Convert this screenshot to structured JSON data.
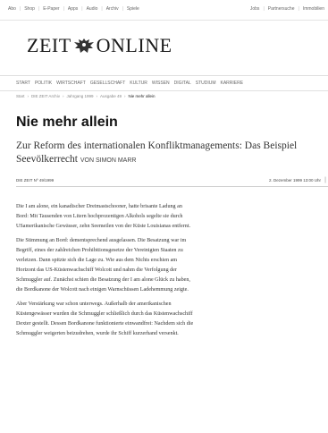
{
  "topnav": {
    "left": [
      "Abo",
      "Shop",
      "E-Paper",
      "Apps",
      "Audio",
      "Archiv",
      "Spiele"
    ],
    "right": [
      "Jobs",
      "Partnersuche",
      "Immobilien"
    ]
  },
  "logo": {
    "part1": "ZEIT",
    "part2": "ONLINE"
  },
  "mainnav": [
    "START",
    "POLITIK",
    "WIRTSCHAFT",
    "GESELLSCHAFT",
    "KULTUR",
    "WISSEN",
    "DIGITAL",
    "STUDIUM",
    "KARRIERE"
  ],
  "breadcrumb": [
    "Start",
    "DIE ZEIT Archiv",
    "Jahrgang 1999",
    "Ausgabe 49",
    "Nie mehr allein"
  ],
  "article": {
    "title": "Nie mehr allein",
    "subtitle": "Zur Reform des internationalen Konfliktmanagements: Das Beispiel Seevölkerrecht",
    "byline": "VON SIMON MARR",
    "issue": "DIE ZEIT Nº 49/1999",
    "date": "2. Dezember 1999  13:00 Uhr",
    "paragraphs": [
      [
        "Die I am alone, ein kanadischer Dreimastschooner, hatte brisante Ladung an",
        "Bord: Mit Tausenden von Litern hochprozentigen Alkohols segelte sie durch",
        "USamerikanische Gewässer, zehn Seemeilen von der Küste Louisianas entfernt."
      ],
      [
        "Die Stimmung an Bord: dementsprechend ausgelassen. Die Besatzung war im",
        "Begriff, eines der zahlreichen Prohibitionsgesetze der Vereinigten Staaten zu",
        "verletzen. Dann spitzte sich die Lage zu. Wie aus dem Nichts erschien am",
        "Horizont das US-Küstenwachschiff Wolcott und nahm die Verfolgung der",
        "Schmuggler auf. Zunächst schien die Besatzung der I am alone Glück zu haben,",
        "die Bordkanone der Wolcott nach einigen Warnschüssen Ladehemmung zeigte."
      ],
      [
        "Aber Verstärkung war schon unterwegs. Außerhalb der amerikanischen",
        "Küstengewässer wurden die Schmuggler schließlich durch das Küstenwachschiff",
        "Dexter gestellt. Dessen Bordkanone funktionierte einwandfrei: Nachdem sich die",
        "Schmuggler weigerten beizudrehen, wurde ihr Schiff kurzerhand versenkt."
      ]
    ]
  }
}
